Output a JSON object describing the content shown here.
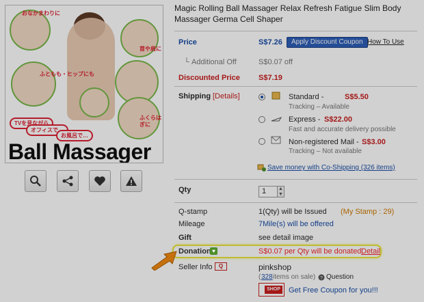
{
  "product": {
    "title": "Magic Rolling Ball Massager Relax Refresh Fatigue Slim Body Massager Germa Cell Shaper",
    "image": {
      "caption_lines": [
        "おなかまわりに",
        "首や肩に",
        "ふともも・ヒップにも",
        "ふくらはぎに"
      ],
      "bubbles": [
        "TVを見ながら",
        "オフィスで…",
        "お風呂で…"
      ],
      "logo_text": "Ball Massager"
    }
  },
  "actions": {
    "icons": [
      "zoom-icon",
      "share-icon",
      "heart-icon",
      "warning-icon"
    ]
  },
  "price": {
    "label": "Price",
    "value": "S$7.26",
    "apply_button": "Apply Discount Coupon",
    "how_to_use": "How To Use",
    "additional_off_label": "Additional Off",
    "additional_off_value": "S$0.07 off",
    "discounted_label": "Discounted Price",
    "discounted_value": "S$7.19"
  },
  "shipping": {
    "label": "Shipping",
    "details_link": "[Details]",
    "options": [
      {
        "name": "Standard -",
        "price": "S$5.50",
        "note": "Tracking – Available",
        "selected": true
      },
      {
        "name": "Express -",
        "price": "S$22.00",
        "note": "Fast and accurate delivery possible",
        "selected": false
      },
      {
        "name": "Non-registered Mail -",
        "price": "S$3.00",
        "note": "Tracking – Not available",
        "selected": false
      }
    ],
    "co_shipping": "Save money with Co-Shipping (326 items)"
  },
  "qty": {
    "label": "Qty",
    "value": "1"
  },
  "qstamp": {
    "label": "Q-stamp",
    "text": "1(Qty) will be Issued",
    "my_stamp": "(My Stamp : 29)"
  },
  "mileage": {
    "label": "Mileage",
    "text": "7Mile(s) will be offered"
  },
  "gift": {
    "label": "Gift",
    "text": "see detail image"
  },
  "donation": {
    "label": "Donation",
    "text": "S$0.07 per Qty will be donated.",
    "detail_link": "Detail"
  },
  "seller": {
    "label": "Seller Info",
    "badge": "Q",
    "name": "pinkshop",
    "items_open": "(",
    "items_count": "328",
    "items_suffix": " items on sale)",
    "question": "Question",
    "coupon_icon_text": "SHOP",
    "coupon_text": "Get Free Coupon for you!!!"
  },
  "colors": {
    "accent_blue": "#1a4ea8",
    "price_red": "#c81e1e",
    "highlight_yellow": "#e9e63b",
    "arrow_orange": "#f08a12"
  }
}
